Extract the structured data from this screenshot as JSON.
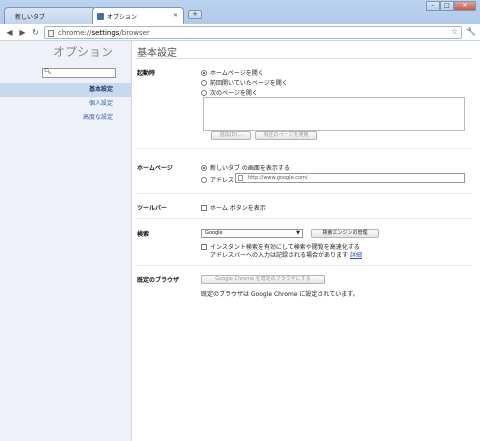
{
  "tabs": [
    {
      "label": "新しいタブ"
    },
    {
      "label": "オプション"
    }
  ],
  "window_controls": {
    "minimize": "–",
    "maximize": "□",
    "close": "✕"
  },
  "new_tab": "+",
  "toolbar": {
    "url_prefix": "chrome://",
    "url_host": "settings",
    "url_path": "/browser"
  },
  "sidebar": {
    "title": "オプション",
    "search_placeholder": "",
    "items": [
      {
        "label": "基本設定"
      },
      {
        "label": "個人設定"
      },
      {
        "label": "高度な設定"
      }
    ]
  },
  "main": {
    "title": "基本設定",
    "startup": {
      "label": "起動時",
      "options": [
        "ホームページを開く",
        "前回開いていたページを開く",
        "次のページを開く"
      ],
      "selected_index": 0,
      "add_button": "追加(D)...",
      "use_current_button": "現在のページを使用"
    },
    "homepage": {
      "label": "ホームページ",
      "options": [
        "新しいタブ の画面を表示する",
        "アドレス"
      ],
      "selected_index": 0,
      "address_value": "http://www.google.com/"
    },
    "toolbar_section": {
      "label": "ツールバー",
      "checkbox": "ホーム ボタンを表示"
    },
    "search": {
      "label": "検索",
      "engine": "Google",
      "manage_button": "検索エンジンの管理",
      "instant_line1": "インスタント検索を有効にして検索や閲覧を高速化する",
      "instant_line2": "アドレスバーへの入力は記録される場合があります",
      "instant_link": "詳細"
    },
    "default_browser": {
      "label": "既定のブラウザ",
      "button": "Google Chrome を既定のブラウザにする",
      "status": "既定のブラウザは Google Chrome に設定されています。"
    }
  }
}
